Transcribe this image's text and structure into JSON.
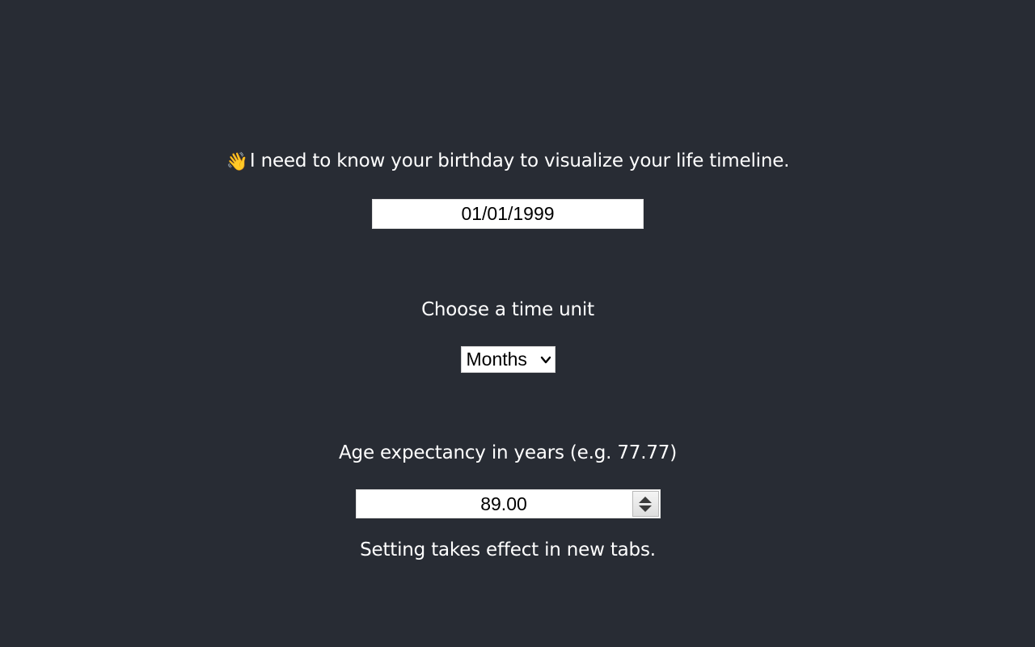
{
  "birthday": {
    "prompt_icon": "👋",
    "prompt": "I need to know your birthday to visualize your life timeline.",
    "value": "01/01/1999"
  },
  "time_unit": {
    "label": "Choose a time unit",
    "selected": "Months"
  },
  "age_expectancy": {
    "label": "Age expectancy in years (e.g. 77.77)",
    "value": "89.00",
    "note": "Setting takes effect in new tabs."
  }
}
